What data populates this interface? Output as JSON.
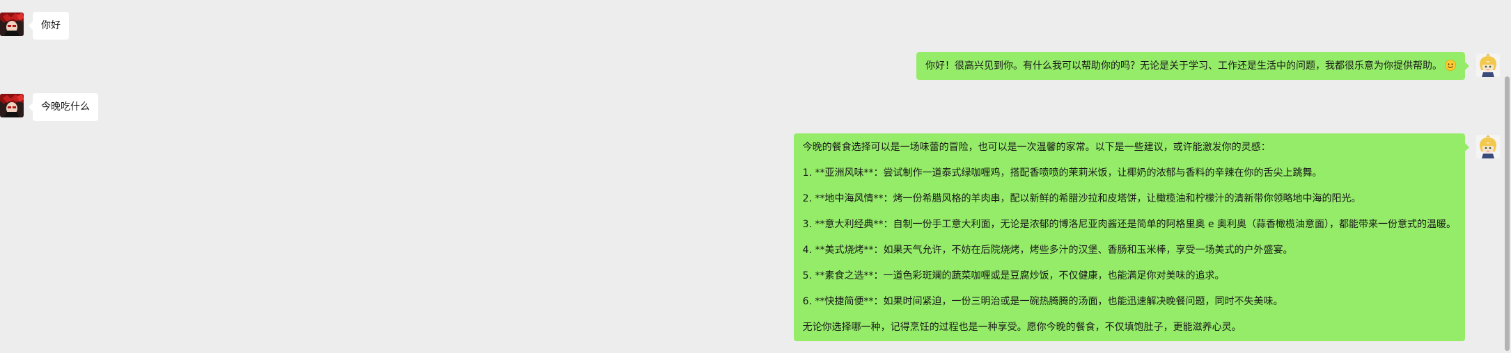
{
  "messages": [
    {
      "id": 1,
      "side": "in",
      "text": "你好"
    },
    {
      "id": 2,
      "side": "out",
      "text": "你好！很高兴见到你。有什么我可以帮助你的吗？无论是关于学习、工作还是生活中的问题，我都很乐意为你提供帮助。",
      "emoji": "smiling-face-emoji"
    },
    {
      "id": 3,
      "side": "in",
      "text": "今晚吃什么"
    },
    {
      "id": 4,
      "side": "out",
      "paragraphs": [
        "今晚的餐食选择可以是一场味蕾的冒险，也可以是一次温馨的家常。以下是一些建议，或许能激发你的灵感：",
        "1. **亚洲风味**：尝试制作一道泰式绿咖喱鸡，搭配香喷喷的茉莉米饭，让椰奶的浓郁与香料的辛辣在你的舌尖上跳舞。",
        "2. **地中海风情**：烤一份希腊风格的羊肉串，配以新鲜的希腊沙拉和皮塔饼，让橄榄油和柠檬汁的清新带你领略地中海的阳光。",
        "3. **意大利经典**：自制一份手工意大利面，无论是浓郁的博洛尼亚肉酱还是简单的阿格里奥 e 奥利奥（蒜香橄榄油意面），都能带来一份意式的温暖。",
        "4. **美式烧烤**：如果天气允许，不妨在后院烧烤，烤些多汁的汉堡、香肠和玉米棒，享受一场美式的户外盛宴。",
        "5. **素食之选**：一道色彩斑斓的蔬菜咖喱或是豆腐炒饭，不仅健康，也能满足你对美味的追求。",
        "6. **快捷简便**：如果时间紧迫，一份三明治或是一碗热腾腾的汤面，也能迅速解决晚餐问题，同时不失美味。",
        "无论你选择哪一种，记得烹饪的过程也是一种享受。愿你今晚的餐食，不仅填饱肚子，更能滋养心灵。"
      ]
    }
  ],
  "colors": {
    "background": "#ededed",
    "bubble_out": "#95ec69",
    "bubble_in": "#ffffff",
    "text": "#191919"
  }
}
